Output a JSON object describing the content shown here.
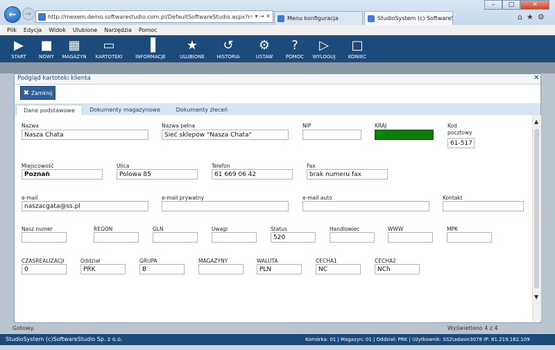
{
  "browser": {
    "address": "http://mexem.demo.softwarestudio.com.pl/DefaultSoftwareStudio.aspx?rola=MI",
    "address_controls": "⌕ ▾ → ✕",
    "tabs": [
      {
        "label": "Menu konfiguracja"
      },
      {
        "label": "StudioSystem (c) SoftwareS..."
      }
    ],
    "window_controls": {
      "minimize": "–",
      "maximize": "□",
      "close": "✕"
    },
    "right_tools": {
      "home": "⌂",
      "star": "★",
      "gear": "⚙"
    }
  },
  "menubar": [
    "Plik",
    "Edycja",
    "Widok",
    "Ulubione",
    "Narzędzia",
    "Pomoc"
  ],
  "toolbar": [
    {
      "label": "START",
      "icon": "▶",
      "icon_name": "play-icon"
    },
    {
      "label": "NOWY",
      "icon": "■",
      "icon_name": "new-doc-icon"
    },
    {
      "label": "MAGAZYN",
      "icon": "▦",
      "icon_name": "warehouse-icon"
    },
    {
      "label": "KARTOTEKI",
      "icon": "▭",
      "icon_name": "cards-icon"
    },
    {
      "label": "INFORMACJE",
      "icon": "▐",
      "icon_name": "chart-icon"
    },
    {
      "label": "ULUBIONE",
      "icon": "★",
      "icon_name": "favorites-icon"
    },
    {
      "label": "HISTORIA",
      "icon": "↺",
      "icon_name": "history-icon"
    },
    {
      "label": "USTAW",
      "icon": "⚙",
      "icon_name": "settings-icon"
    },
    {
      "label": "POMOC",
      "icon": "?",
      "icon_name": "help-icon"
    },
    {
      "label": "WYLOGUJ",
      "icon": "▷",
      "icon_name": "logout-icon"
    },
    {
      "label": "KONIEC",
      "icon": "□",
      "icon_name": "exit-icon"
    }
  ],
  "modal": {
    "title": "Podgląd kartoteki klienta",
    "close_x": "✕",
    "close_button": "Zamknij",
    "close_icon": "✖",
    "tabs": [
      "Dane podstawowe",
      "Dokumenty magazynowe",
      "Dokumenty zleceń"
    ],
    "fields": {
      "nazwa": {
        "label": "Nazwa",
        "value": "Nasza Chata"
      },
      "nazwa_pelna": {
        "label": "Nazwa pełna",
        "value": "Sieć sklepów \"Nasza Chata\""
      },
      "nip": {
        "label": "NIP",
        "value": ""
      },
      "kraj": {
        "label": "KRAJ",
        "value": "PL"
      },
      "kod": {
        "label": "Kod pocztowy",
        "value": "61-517"
      },
      "miejscowosc": {
        "label": "Miejscowość",
        "value": "Poznań"
      },
      "ulica": {
        "label": "Ulica",
        "value": "Polowa 85"
      },
      "telefon": {
        "label": "Telefon",
        "value": "61 669 06 42"
      },
      "fax": {
        "label": "Fax",
        "value": "brak numeru fax"
      },
      "email": {
        "label": "e-mail",
        "value": "naszacgata@ss.pl"
      },
      "email_prywatny": {
        "label": "e-mail prywatny",
        "value": ""
      },
      "email_auto": {
        "label": "e-mail auto",
        "value": ""
      },
      "kontakt": {
        "label": "Kontakt",
        "value": ""
      },
      "nasz_numer": {
        "label": "Nasz numer",
        "value": ""
      },
      "regon": {
        "label": "REGON",
        "value": ""
      },
      "gln": {
        "label": "GLN",
        "value": ""
      },
      "uwagi": {
        "label": "Uwagi",
        "value": ""
      },
      "status": {
        "label": "Status",
        "value": "520"
      },
      "handlowiec": {
        "label": "Handlowiec",
        "value": ""
      },
      "www": {
        "label": "WWW",
        "value": ""
      },
      "mpk": {
        "label": "MPK",
        "value": ""
      },
      "czasrealizacji": {
        "label": "CZASREALIZACJI",
        "value": "0"
      },
      "oddzial": {
        "label": "Oddział",
        "value": "PRK"
      },
      "grupa": {
        "label": "GRUPA",
        "value": "B"
      },
      "magazyny": {
        "label": "MAGAZYNY",
        "value": ""
      },
      "waluta": {
        "label": "WALUTA",
        "value": "PLN"
      },
      "cecha1": {
        "label": "CECHA1",
        "value": "NC"
      },
      "cecha2": {
        "label": "CECHA2",
        "value": "NCh"
      }
    },
    "scroll_up": "▲",
    "scroll_down": "▼"
  },
  "status": {
    "ready": "Gotowy.",
    "shown": "Wyświetlono 4 z 4",
    "app_left": "StudioSystem (c)SoftwareStudio Sp. z o.o.",
    "app_right": "Komórka: 01 | Magazyn: 01 | Oddział: PRK | Użytkownik: SS2\\adasie3078 IP: 81.219.162.109"
  },
  "colors": {
    "kraj_bg": "#0b7d0b",
    "toolbar_bg": "#1c4a7a",
    "accent": "#2f5f96"
  }
}
